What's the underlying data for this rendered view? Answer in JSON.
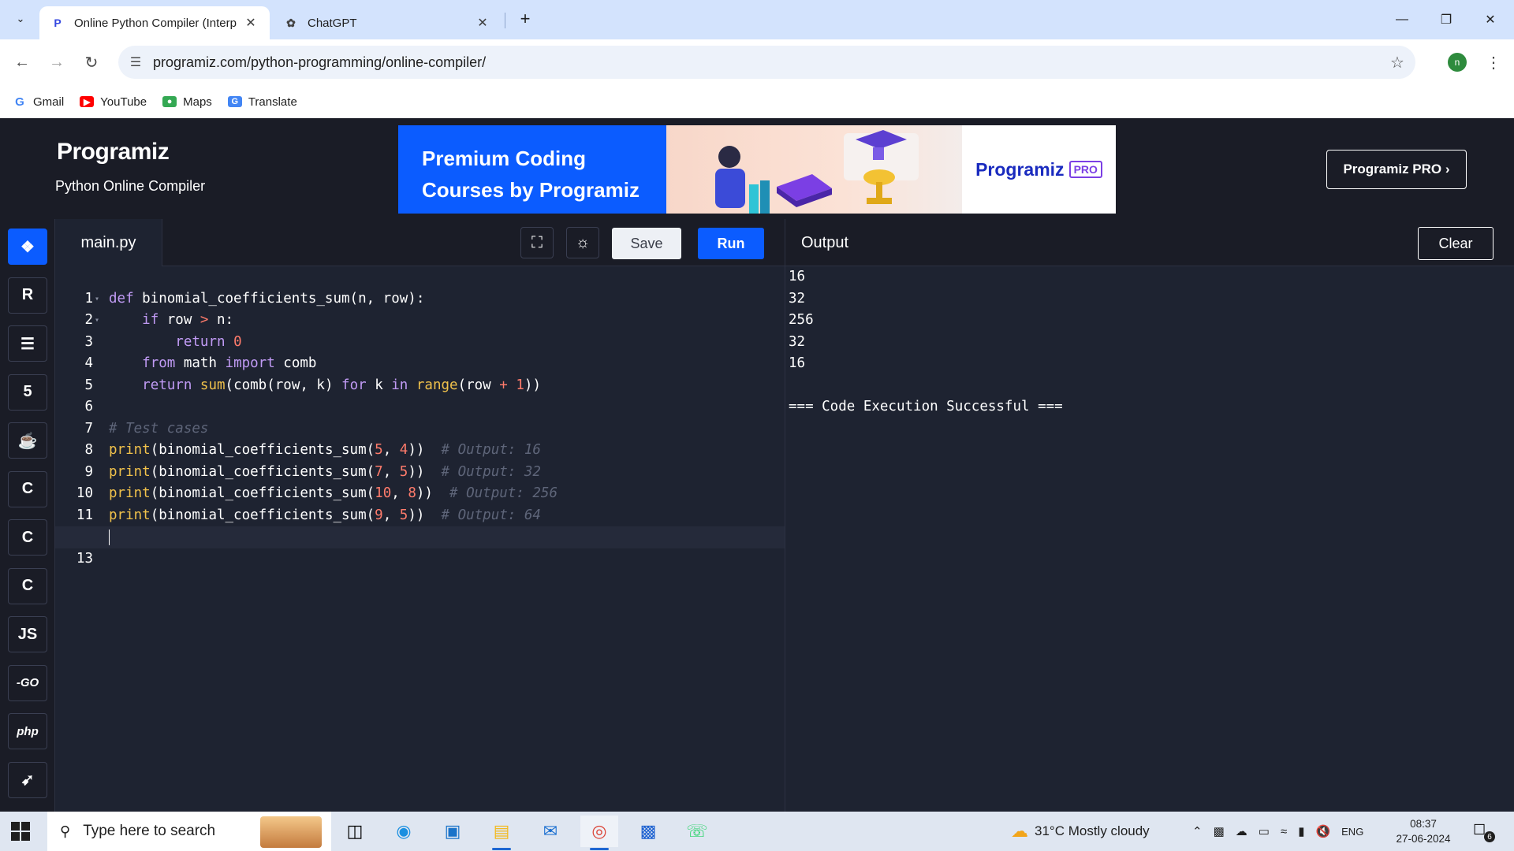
{
  "browser": {
    "tabs": [
      {
        "title": "Online Python Compiler (Interp",
        "active": true
      },
      {
        "title": "ChatGPT",
        "active": false
      }
    ],
    "url": "programiz.com/python-programming/online-compiler/",
    "profile_initial": "n",
    "bookmarks": [
      "Gmail",
      "YouTube",
      "Maps",
      "Translate"
    ]
  },
  "header": {
    "logo": "Programiz",
    "subtitle": "Python Online Compiler",
    "banner": {
      "line1": "Premium Coding",
      "line2": "Courses by Programiz",
      "brand": "Programiz",
      "pro_badge": "PRO"
    },
    "pro_button": "Programiz PRO ›"
  },
  "sidebar": {
    "languages": [
      {
        "name": "python-icon",
        "label": "",
        "active": true
      },
      {
        "name": "r-icon",
        "label": "R",
        "active": false
      },
      {
        "name": "sql-icon",
        "label": "",
        "active": false
      },
      {
        "name": "html-icon",
        "label": "5",
        "active": false
      },
      {
        "name": "java-icon",
        "label": "",
        "active": false
      },
      {
        "name": "c-icon",
        "label": "C",
        "active": false
      },
      {
        "name": "cpp-icon",
        "label": "C",
        "active": false
      },
      {
        "name": "csharp-icon",
        "label": "C",
        "active": false
      },
      {
        "name": "js-icon",
        "label": "JS",
        "active": false
      },
      {
        "name": "go-icon",
        "label": "-GO",
        "active": false
      },
      {
        "name": "php-icon",
        "label": "php",
        "active": false
      },
      {
        "name": "swift-icon",
        "label": "",
        "active": false
      }
    ]
  },
  "editor": {
    "filename": "main.py",
    "save_label": "Save",
    "run_label": "Run"
  },
  "output": {
    "title": "Output",
    "clear_label": "Clear",
    "lines": [
      "16",
      "32",
      "256",
      "32",
      "16",
      "",
      "=== Code Execution Successful ==="
    ]
  },
  "taskbar": {
    "search_placeholder": "Type here to search",
    "weather": "31°C  Mostly cloudy",
    "language": "ENG",
    "time": "08:37",
    "date": "27-06-2024",
    "notifications": "6"
  }
}
